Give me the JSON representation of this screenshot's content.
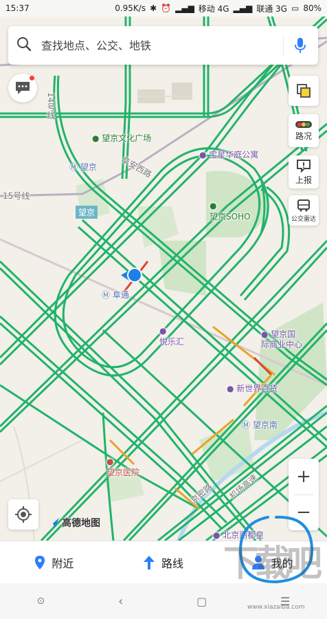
{
  "status_bar": {
    "time": "15:37",
    "speed": "0.95K/s",
    "carrier1": "移动 4G",
    "carrier2": "联通 3G",
    "battery": "80%"
  },
  "search": {
    "placeholder": "查找地点、公交、地铁"
  },
  "right_tools": {
    "traffic_label": "路况",
    "report_label": "上报",
    "bus_radar_label": "公交雷达"
  },
  "map_labels": {
    "wangjing_culture_square": "望京文化广场",
    "wangjing_station": "望京",
    "wangjing_district": "望京",
    "baoxing_apartment": "宝星华庭公寓",
    "wangjing_soho": "望京SOHO",
    "futong_station": "阜通",
    "yuelehui": "悦乐汇",
    "wangjing_international": "望京国际商业中心",
    "new_world_store": "新世界百货",
    "wangjingnan_station": "望京南",
    "wangjing_hospital": "望京医院",
    "beijing_lidu": "北京丽都皇",
    "line15": "15号线",
    "line14": "14号线",
    "road_fuan": "阜安西路",
    "road_jichang": "机场高速",
    "road_jingcheng": "京密路"
  },
  "map_controls": {
    "zoom_in": "+",
    "zoom_out": "−"
  },
  "logo": {
    "text": "高德地图"
  },
  "bottom_tabs": {
    "nearby": "附近",
    "route": "路线",
    "mine": "我的"
  },
  "watermark": {
    "text": "下载吧",
    "url": "www.xiazaiba.com"
  },
  "colors": {
    "road_green": "#21b36b",
    "road_red": "#d9453a",
    "road_orange": "#e8a324",
    "accent_blue": "#2d7ff9",
    "annotation_circle": "#1d8fe0"
  }
}
